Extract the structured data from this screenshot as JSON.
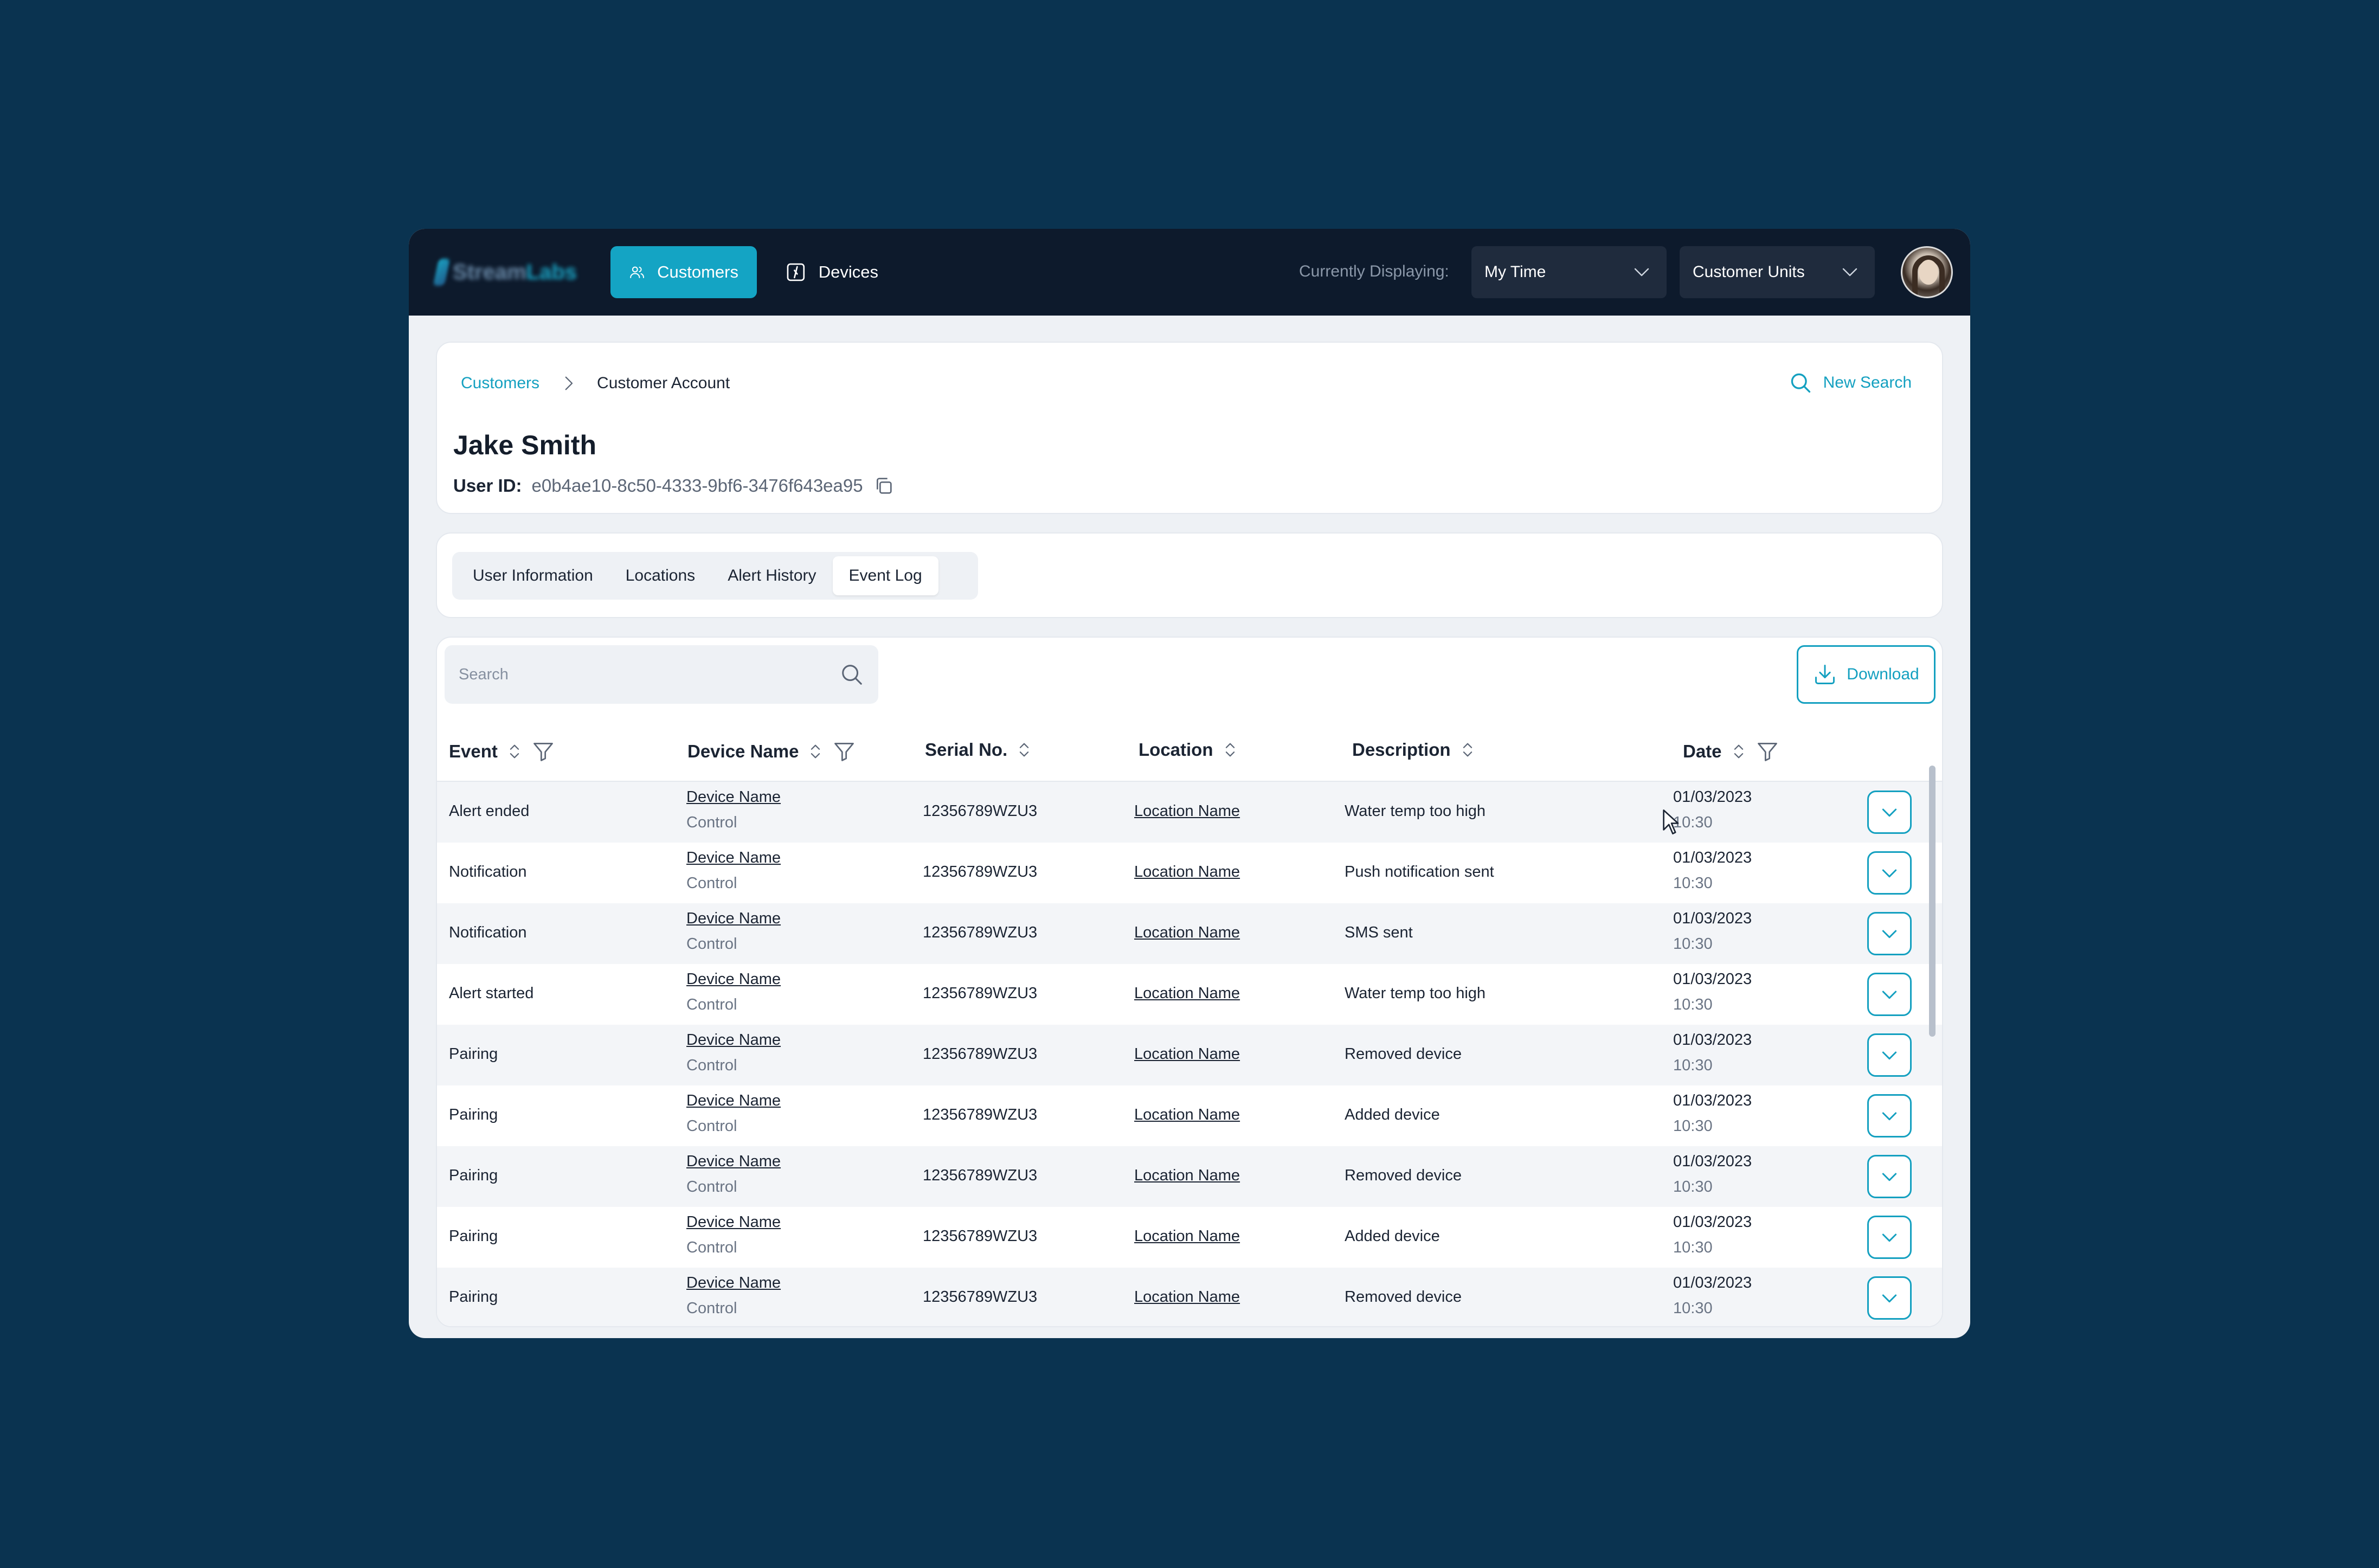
{
  "nav": {
    "logo_text": "Stream",
    "logo_accent": "Labs",
    "customers_label": "Customers",
    "devices_label": "Devices",
    "display_label": "Currently Displaying:",
    "time_select": "My Time",
    "units_select": "Customer Units"
  },
  "breadcrumb": {
    "root": "Customers",
    "current": "Customer Account"
  },
  "new_search_label": "New Search",
  "customer": {
    "name": "Jake Smith",
    "user_id_label": "User ID:",
    "user_id": "e0b4ae10-8c50-4333-9bf6-3476f643ea95"
  },
  "tabs": [
    "User Information",
    "Locations",
    "Alert History",
    "Event Log"
  ],
  "active_tab": "Event Log",
  "search_placeholder": "Search",
  "download_label": "Download",
  "columns": {
    "event": "Event",
    "device": "Device Name",
    "serial": "Serial No.",
    "location": "Location",
    "description": "Description",
    "date": "Date"
  },
  "rows": [
    {
      "event": "Alert ended",
      "device": "Device Name",
      "device_type": "Control",
      "serial": "12356789WZU3",
      "location": "Location Name",
      "description": "Water temp too high",
      "date": "01/03/2023",
      "time": "10:30"
    },
    {
      "event": "Notification",
      "device": "Device Name",
      "device_type": "Control",
      "serial": "12356789WZU3",
      "location": "Location Name",
      "description": "Push notification sent",
      "date": "01/03/2023",
      "time": "10:30"
    },
    {
      "event": "Notification",
      "device": "Device Name",
      "device_type": "Control",
      "serial": "12356789WZU3",
      "location": "Location Name",
      "description": "SMS sent",
      "date": "01/03/2023",
      "time": "10:30"
    },
    {
      "event": "Alert started",
      "device": "Device Name",
      "device_type": "Control",
      "serial": "12356789WZU3",
      "location": "Location Name",
      "description": "Water temp too high",
      "date": "01/03/2023",
      "time": "10:30"
    },
    {
      "event": "Pairing",
      "device": "Device Name",
      "device_type": "Control",
      "serial": "12356789WZU3",
      "location": "Location Name",
      "description": "Removed device",
      "date": "01/03/2023",
      "time": "10:30"
    },
    {
      "event": "Pairing",
      "device": "Device Name",
      "device_type": "Control",
      "serial": "12356789WZU3",
      "location": "Location Name",
      "description": "Added device",
      "date": "01/03/2023",
      "time": "10:30"
    },
    {
      "event": "Pairing",
      "device": "Device Name",
      "device_type": "Control",
      "serial": "12356789WZU3",
      "location": "Location Name",
      "description": "Removed device",
      "date": "01/03/2023",
      "time": "10:30"
    },
    {
      "event": "Pairing",
      "device": "Device Name",
      "device_type": "Control",
      "serial": "12356789WZU3",
      "location": "Location Name",
      "description": "Added device",
      "date": "01/03/2023",
      "time": "10:30"
    },
    {
      "event": "Pairing",
      "device": "Device Name",
      "device_type": "Control",
      "serial": "12356789WZU3",
      "location": "Location Name",
      "description": "Removed device",
      "date": "01/03/2023",
      "time": "10:30"
    }
  ],
  "colors": {
    "background": "#0a3350",
    "topbar": "#0d1a2c",
    "accent": "#14a4c4",
    "text": "#1b2433"
  },
  "icons": {
    "customers": "users-icon",
    "devices": "device-icon",
    "dropdown": "chevron-down-icon",
    "breadcrumb_sep": "chevron-right-icon",
    "search": "search-icon",
    "copy": "copy-icon",
    "download": "download-icon",
    "sort": "sort-icon",
    "filter": "filter-icon",
    "expand": "chevron-down-icon"
  }
}
